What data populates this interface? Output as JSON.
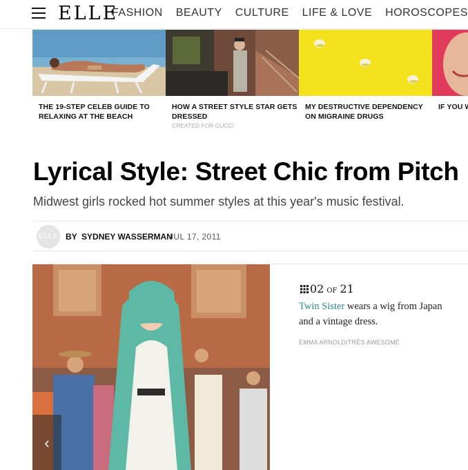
{
  "header": {
    "logo": "ELLE",
    "nav": [
      "FASHION",
      "BEAUTY",
      "CULTURE",
      "LIFE & LOVE",
      "HOROSCOPES"
    ]
  },
  "carousel": [
    {
      "title": "THE 19-STEP CELEB GUIDE TO RELAXING AT THE BEACH",
      "sponsor": ""
    },
    {
      "title": "HOW A STREET STYLE STAR GETS DRESSED",
      "sponsor": "CREATED FOR GUCCI"
    },
    {
      "title": "MY DESTRUCTIVE DEPENDENCY ON MIGRAINE DRUGS",
      "sponsor": ""
    },
    {
      "title": "IF YOU W WATCH Y",
      "sponsor": ""
    }
  ],
  "article": {
    "headline": "Lyrical Style: Street Chic from Pitch",
    "dek": "Midwest girls rocked hot summer styles at this year's music festival.",
    "avatar_text": "ELLE",
    "byline_prefix": "BY",
    "author": "SYDNEY WASSERMAN",
    "date": "JUL 17, 2011"
  },
  "gallery": {
    "current": "02",
    "of_label": "OF",
    "total": "21",
    "caption_link": "Twin Sister",
    "caption_rest": " wears a wig from Japan and a vintage dress.",
    "credit": "EMMA ARNOLD/TRÈS AWESOME",
    "prev_arrow": "‹"
  }
}
